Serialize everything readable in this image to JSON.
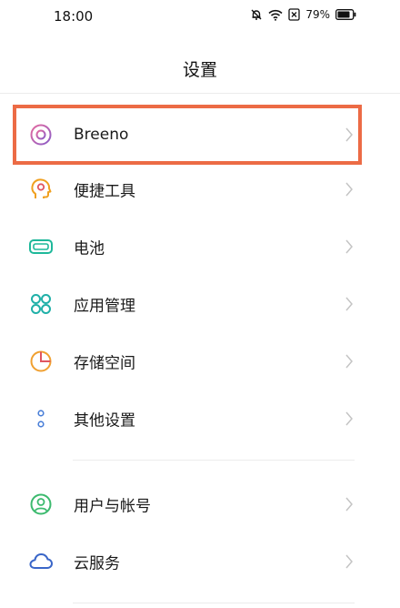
{
  "status_bar": {
    "time": "18:00",
    "battery_percent": "79%"
  },
  "header": {
    "title": "设置"
  },
  "settings": {
    "items": [
      {
        "label": "Breeno",
        "icon": "breeno-icon",
        "icon_color": "#a65fb0"
      },
      {
        "label": "便捷工具",
        "icon": "assistant-head-icon",
        "icon_color": "#f0a020"
      },
      {
        "label": "电池",
        "icon": "battery-icon",
        "icon_color": "#1eb89a"
      },
      {
        "label": "应用管理",
        "icon": "app-grid-icon",
        "icon_color": "#20b0a8"
      },
      {
        "label": "存储空间",
        "icon": "pie-chart-icon",
        "icon_color": "#f0a030"
      },
      {
        "label": "其他设置",
        "icon": "dots-icon",
        "icon_color": "#4a7fd8"
      },
      {
        "label": "用户与帐号",
        "icon": "user-account-icon",
        "icon_color": "#3cba6e"
      },
      {
        "label": "云服务",
        "icon": "cloud-icon",
        "icon_color": "#3a66c8"
      }
    ]
  },
  "highlight": {
    "color": "#ec6b45"
  }
}
